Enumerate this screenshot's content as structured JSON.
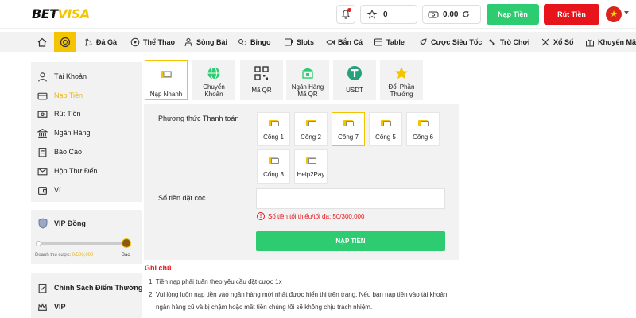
{
  "header": {
    "logo_main": "BET",
    "logo_accent": "VISA",
    "points": "0",
    "balance": "0.00",
    "deposit_label": "Nạp Tiền",
    "withdraw_label": "Rút Tiền"
  },
  "nav": {
    "items": [
      {
        "label": "Đá Gà",
        "icon": "rooster-icon"
      },
      {
        "label": "Thể Thao",
        "icon": "football-icon"
      },
      {
        "label": "Sòng Bài",
        "icon": "dealer-icon"
      },
      {
        "label": "Bingo",
        "icon": "bingo-icon"
      },
      {
        "label": "Slots",
        "icon": "slots-icon"
      },
      {
        "label": "Bắn Cá",
        "icon": "fish-icon"
      },
      {
        "label": "Table",
        "icon": "table-icon"
      },
      {
        "label": "Cược Siêu Tốc",
        "icon": "rocket-icon"
      },
      {
        "label": "Trò Chơi",
        "icon": "game-icon"
      },
      {
        "label": "Xổ Số",
        "icon": "lottery-icon"
      },
      {
        "label": "Khuyến Mãi",
        "icon": "gift-icon"
      }
    ]
  },
  "sidebar": {
    "items": [
      {
        "label": "Tài Khoản",
        "icon": "user-icon"
      },
      {
        "label": "Nạp Tiền",
        "icon": "wallet-icon"
      },
      {
        "label": "Rút Tiền",
        "icon": "cash-icon"
      },
      {
        "label": "Ngân Hàng",
        "icon": "bank-icon"
      },
      {
        "label": "Báo Cáo",
        "icon": "report-icon"
      },
      {
        "label": "Hộp Thư Đến",
        "icon": "mail-icon"
      },
      {
        "label": "Ví",
        "icon": "purse-icon"
      }
    ],
    "vip": {
      "title": "VIP Đồng",
      "turnover_label": "Doanh thu cược:",
      "turnover_value": "0/500,000",
      "next_level": "Bạc",
      "progress": 0
    },
    "bottom": [
      {
        "label": "Chính Sách Điểm Thưởng",
        "icon": "policy-icon"
      },
      {
        "label": "VIP",
        "icon": "crown-icon"
      }
    ]
  },
  "methods": [
    {
      "label": "Nạp Nhanh",
      "icon": "fast-card-icon"
    },
    {
      "label": "Chuyển Khoản",
      "icon": "globe-icon"
    },
    {
      "label": "Mã QR",
      "icon": "qr-icon"
    },
    {
      "label": "Ngân Hàng Mã QR",
      "icon": "bank-qr-icon"
    },
    {
      "label": "USDT",
      "icon": "usdt-icon"
    },
    {
      "label": "Đổi Phần Thưởng",
      "icon": "star-icon"
    }
  ],
  "form": {
    "method_label": "Phương thức Thanh toán",
    "gates": [
      "Cổng 1",
      "Cổng 2",
      "Cổng 7",
      "Cổng 5",
      "Cổng 6",
      "Cổng 3",
      "Help2Pay"
    ],
    "amount_label": "Số tiền đặt cọc",
    "amount_value": "",
    "hint": "Số tiền tối thiểu/tối đa: 50/300,000",
    "submit_label": "NẠP TIỀN"
  },
  "notes": {
    "title": "Ghi chú",
    "lines": [
      "1. Tiền nạp phải tuân theo yêu cầu đặt cược 1x",
      "2. Vui lòng luôn nạp tiền vào ngân hàng mới nhất được hiển thị trên trang. Nếu bạn nạp tiền vào tài khoản",
      "ngân hàng cũ và bị chậm hoặc mất tiền chúng tôi sẽ không chịu trách nhiệm."
    ]
  }
}
